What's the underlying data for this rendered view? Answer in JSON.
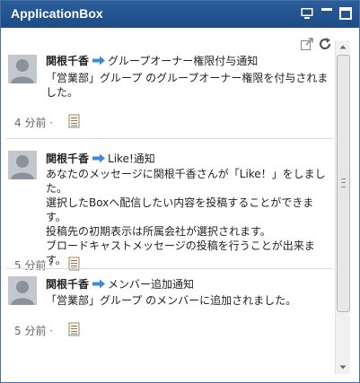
{
  "window": {
    "title": "ApplicationBox"
  },
  "notifications": [
    {
      "user": "関根千香",
      "type": "グループオーナー権限付与通知",
      "lines": [
        "「営業部」グループ のグループオーナー権限を付与されました。"
      ],
      "time": "4 分前 ·"
    },
    {
      "user": "関根千香",
      "type": "Like!通知",
      "lines": [
        "あなたのメッセージに関根千香さんが「Like！」をしました。",
        "選択したBoxへ配信したい内容を投稿することができます。",
        "投稿先の初期表示は所属会社が選択されます。",
        "ブロードキャストメッセージの投稿を行うことが出来ます。"
      ],
      "time": "5 分前 ·"
    },
    {
      "user": "関根千香",
      "type": "メンバー追加通知",
      "lines": [
        "「営業部」グループ のメンバーに追加されました。"
      ],
      "time": "5 分前 ·"
    }
  ],
  "colors": {
    "titlebar": "#1f4f8b",
    "arrow": "#3f88d6",
    "divider": "#d8dde5"
  }
}
